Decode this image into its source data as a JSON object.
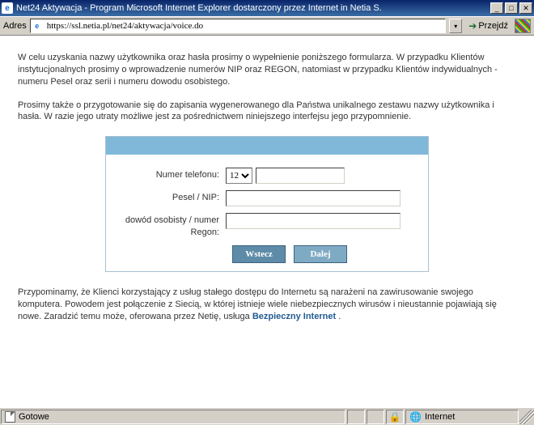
{
  "window": {
    "title": "Net24 Aktywacja - Program Microsoft Internet Explorer dostarczony przez Internet in Netia S."
  },
  "addressbar": {
    "label": "Adres",
    "url": "https://ssl.netia.pl/net24/aktywacja/voice.do",
    "go": "Przejdź"
  },
  "page": {
    "para1": "W celu uzyskania nazwy użytkownika oraz hasła prosimy o wypełnienie poniższego formularza. W przypadku Klientów instytucjonalnych prosimy o wprowadzenie numerów NIP oraz REGON, natomiast w przypadku Klientów indywidualnych - numeru Pesel oraz serii i numeru dowodu osobistego.",
    "para2": "Prosimy także o przygotowanie się do zapisania wygenerowanego dla Państwa unikalnego zestawu nazwy użytkownika i hasła. W razie jego utraty możliwe jest za pośrednictwem niniejszego interfejsu jego przypomnienie.",
    "para3_pre": "Przypominamy, że Klienci korzystający z usług stałego dostępu do Internetu są narażeni na zawirusowanie swojego komputera. Powodem jest połączenie z Siecią, w której istnieje wiele niebezpiecznych wirusów i nieustannie pojawiają się nowe. Zaradzić temu może, oferowana przez Netię, usługa ",
    "para3_link": "Bezpieczny Internet",
    "para3_post": " ."
  },
  "form": {
    "labels": {
      "phone": "Numer telefonu:",
      "pesel": "Pesel / NIP:",
      "regon": "dowód osobisty / numer Regon:"
    },
    "phone_prefix": "12",
    "values": {
      "phone": "",
      "pesel": "",
      "regon": ""
    },
    "buttons": {
      "back": "Wstecz",
      "next": "Dalej"
    }
  },
  "statusbar": {
    "status": "Gotowe",
    "zone": "Internet"
  }
}
